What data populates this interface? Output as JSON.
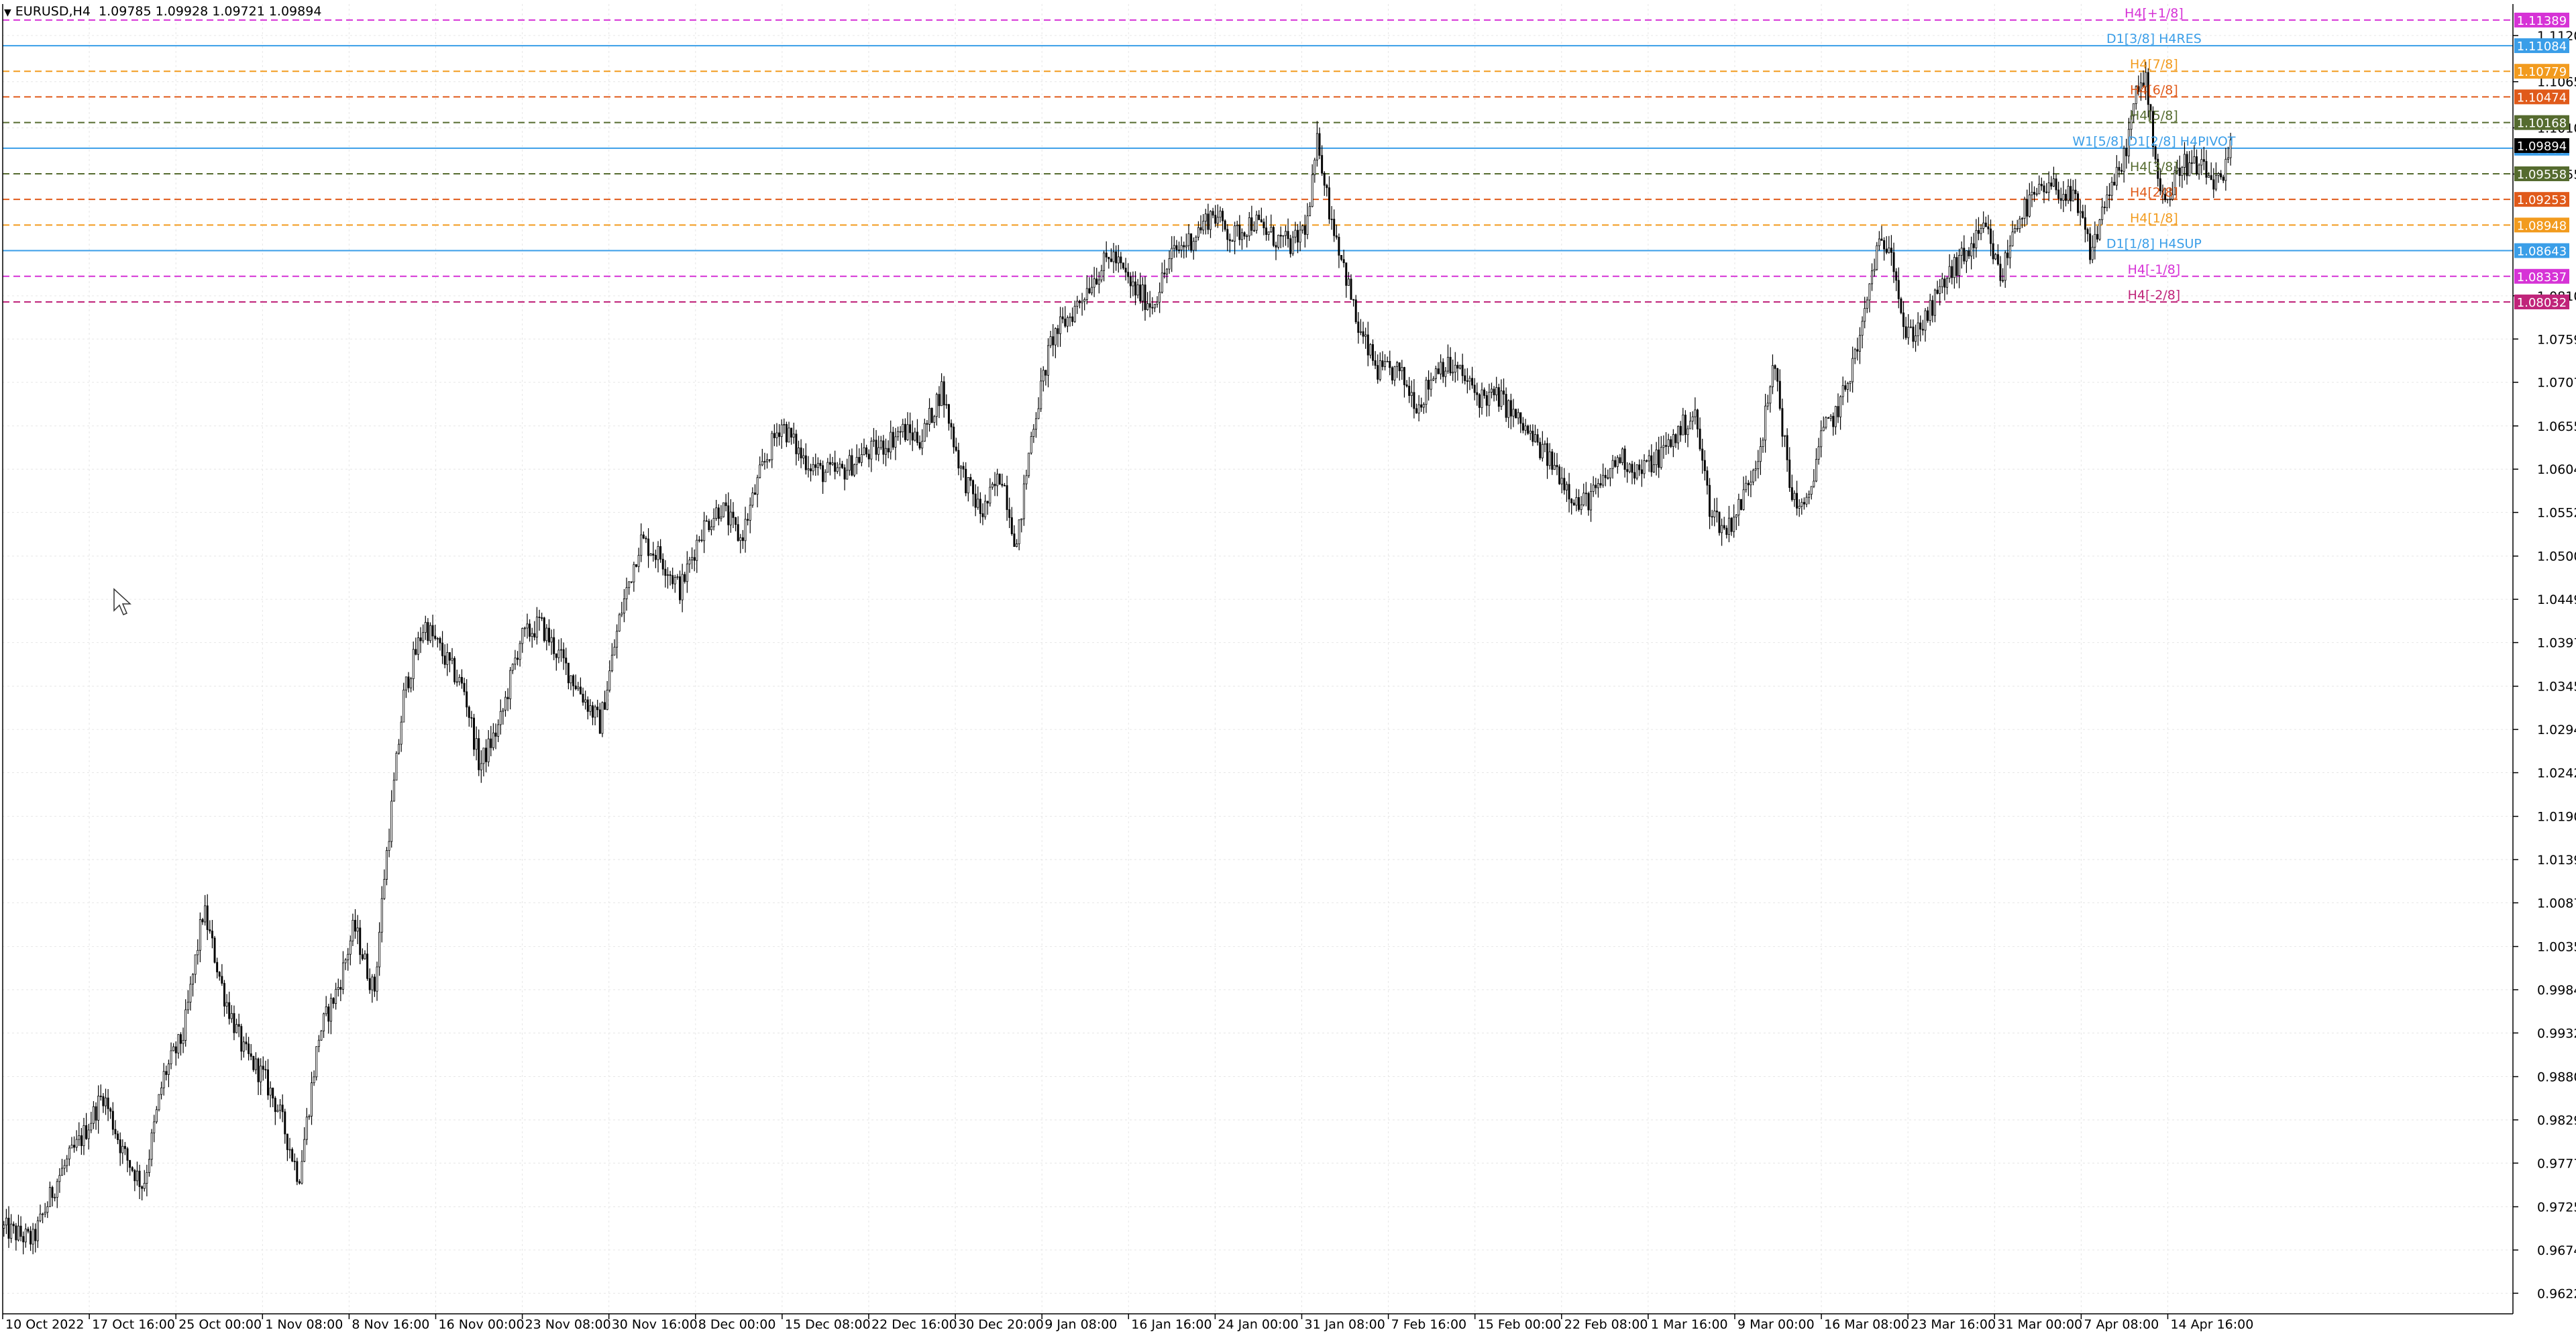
{
  "header": {
    "symbol": "EURUSD,H4",
    "ohlc": "1.09785 1.09928 1.09721 1.09894"
  },
  "chart_data": {
    "type": "candlestick",
    "price_range": [
      0.9598,
      1.1158
    ],
    "y_ticks": [
      "1.11205",
      "1.10655",
      "1.10105",
      "1.09555",
      "1.08105",
      "1.07590",
      "1.07075",
      "1.06555",
      "1.06040",
      "1.05525",
      "1.05005",
      "1.04490",
      "1.03975",
      "1.03455",
      "1.02940",
      "1.02425",
      "1.01905",
      "1.01390",
      "1.00875",
      "1.00355",
      "0.99840",
      "0.99325",
      "0.98805",
      "0.98290",
      "0.97775",
      "0.97255",
      "0.96740",
      "0.96225"
    ],
    "x_ticks": [
      {
        "label": "10 Oct 2022",
        "pos": 0.0
      },
      {
        "label": "17 Oct 16:00",
        "pos": 0.0345
      },
      {
        "label": "25 Oct 00:00",
        "pos": 0.069
      },
      {
        "label": "1 Nov 08:00",
        "pos": 0.1035
      },
      {
        "label": "8 Nov 16:00",
        "pos": 0.138
      },
      {
        "label": "16 Nov 00:00",
        "pos": 0.1725
      },
      {
        "label": "23 Nov 08:00",
        "pos": 0.207
      },
      {
        "label": "30 Nov 16:00",
        "pos": 0.2415
      },
      {
        "label": "8 Dec 00:00",
        "pos": 0.276
      },
      {
        "label": "15 Dec 08:00",
        "pos": 0.3105
      },
      {
        "label": "22 Dec 16:00",
        "pos": 0.345
      },
      {
        "label": "30 Dec 20:00",
        "pos": 0.3795
      },
      {
        "label": "9 Jan 08:00",
        "pos": 0.414
      },
      {
        "label": "16 Jan 16:00",
        "pos": 0.4485
      },
      {
        "label": "24 Jan 00:00",
        "pos": 0.483
      },
      {
        "label": "31 Jan 08:00",
        "pos": 0.5175
      },
      {
        "label": "7 Feb 16:00",
        "pos": 0.552
      },
      {
        "label": "15 Feb 00:00",
        "pos": 0.5865
      },
      {
        "label": "22 Feb 08:00",
        "pos": 0.621
      },
      {
        "label": "1 Mar 16:00",
        "pos": 0.6555
      },
      {
        "label": "9 Mar 00:00",
        "pos": 0.69
      },
      {
        "label": "16 Mar 08:00",
        "pos": 0.7245
      },
      {
        "label": "23 Mar 16:00",
        "pos": 0.759
      },
      {
        "label": "31 Mar 00:00",
        "pos": 0.7935
      },
      {
        "label": "7 Apr 08:00",
        "pos": 0.828
      },
      {
        "label": "14 Apr 16:00",
        "pos": 0.8625
      }
    ],
    "anchors": [
      [
        0.0,
        0.97
      ],
      [
        0.012,
        0.9685
      ],
      [
        0.022,
        0.976
      ],
      [
        0.032,
        0.981
      ],
      [
        0.04,
        0.986
      ],
      [
        0.048,
        0.979
      ],
      [
        0.056,
        0.975
      ],
      [
        0.064,
        0.988
      ],
      [
        0.072,
        0.993
      ],
      [
        0.08,
        1.008
      ],
      [
        0.088,
        0.998
      ],
      [
        0.096,
        0.991
      ],
      [
        0.104,
        0.988
      ],
      [
        0.11,
        0.984
      ],
      [
        0.118,
        0.976
      ],
      [
        0.126,
        0.993
      ],
      [
        0.134,
        0.999
      ],
      [
        0.14,
        1.006
      ],
      [
        0.148,
        0.998
      ],
      [
        0.152,
        1.012
      ],
      [
        0.16,
        1.034
      ],
      [
        0.168,
        1.042
      ],
      [
        0.176,
        1.038
      ],
      [
        0.184,
        1.034
      ],
      [
        0.19,
        1.025
      ],
      [
        0.198,
        1.03
      ],
      [
        0.206,
        1.04
      ],
      [
        0.214,
        1.042
      ],
      [
        0.222,
        1.038
      ],
      [
        0.23,
        1.034
      ],
      [
        0.238,
        1.03
      ],
      [
        0.246,
        1.043
      ],
      [
        0.254,
        1.052
      ],
      [
        0.262,
        1.05
      ],
      [
        0.27,
        1.046
      ],
      [
        0.278,
        1.053
      ],
      [
        0.286,
        1.056
      ],
      [
        0.294,
        1.052
      ],
      [
        0.302,
        1.06
      ],
      [
        0.31,
        1.066
      ],
      [
        0.318,
        1.062
      ],
      [
        0.326,
        1.06
      ],
      [
        0.334,
        1.06
      ],
      [
        0.342,
        1.062
      ],
      [
        0.35,
        1.063
      ],
      [
        0.358,
        1.065
      ],
      [
        0.366,
        1.064
      ],
      [
        0.374,
        1.07
      ],
      [
        0.382,
        1.06
      ],
      [
        0.39,
        1.055
      ],
      [
        0.398,
        1.06
      ],
      [
        0.404,
        1.051
      ],
      [
        0.41,
        1.065
      ],
      [
        0.418,
        1.076
      ],
      [
        0.426,
        1.079
      ],
      [
        0.434,
        1.083
      ],
      [
        0.442,
        1.086
      ],
      [
        0.45,
        1.082
      ],
      [
        0.458,
        1.08
      ],
      [
        0.466,
        1.086
      ],
      [
        0.474,
        1.088
      ],
      [
        0.482,
        1.091
      ],
      [
        0.49,
        1.088
      ],
      [
        0.498,
        1.09
      ],
      [
        0.506,
        1.088
      ],
      [
        0.514,
        1.087
      ],
      [
        0.52,
        1.09
      ],
      [
        0.524,
        1.1
      ],
      [
        0.528,
        1.092
      ],
      [
        0.534,
        1.085
      ],
      [
        0.54,
        1.077
      ],
      [
        0.548,
        1.072
      ],
      [
        0.556,
        1.072
      ],
      [
        0.564,
        1.068
      ],
      [
        0.572,
        1.073
      ],
      [
        0.58,
        1.072
      ],
      [
        0.588,
        1.069
      ],
      [
        0.596,
        1.069
      ],
      [
        0.604,
        1.066
      ],
      [
        0.612,
        1.063
      ],
      [
        0.62,
        1.06
      ],
      [
        0.628,
        1.056
      ],
      [
        0.636,
        1.058
      ],
      [
        0.644,
        1.062
      ],
      [
        0.652,
        1.06
      ],
      [
        0.66,
        1.062
      ],
      [
        0.668,
        1.065
      ],
      [
        0.674,
        1.067
      ],
      [
        0.68,
        1.056
      ],
      [
        0.686,
        1.053
      ],
      [
        0.692,
        1.056
      ],
      [
        0.7,
        1.063
      ],
      [
        0.706,
        1.073
      ],
      [
        0.712,
        1.058
      ],
      [
        0.718,
        1.055
      ],
      [
        0.724,
        1.064
      ],
      [
        0.732,
        1.068
      ],
      [
        0.74,
        1.076
      ],
      [
        0.746,
        1.086
      ],
      [
        0.752,
        1.088
      ],
      [
        0.758,
        1.076
      ],
      [
        0.766,
        1.078
      ],
      [
        0.774,
        1.083
      ],
      [
        0.782,
        1.086
      ],
      [
        0.79,
        1.089
      ],
      [
        0.796,
        1.083
      ],
      [
        0.802,
        1.09
      ],
      [
        0.81,
        1.093
      ],
      [
        0.818,
        1.094
      ],
      [
        0.826,
        1.092
      ],
      [
        0.832,
        1.086
      ],
      [
        0.838,
        1.093
      ],
      [
        0.844,
        1.096
      ],
      [
        0.85,
        1.105
      ],
      [
        0.854,
        1.107
      ],
      [
        0.858,
        1.096
      ],
      [
        0.862,
        1.092
      ],
      [
        0.868,
        1.097
      ],
      [
        0.876,
        1.096
      ],
      [
        0.884,
        1.094
      ],
      [
        0.888,
        1.0989
      ]
    ],
    "murrey_levels": [
      {
        "label": "H4[+1/8]",
        "price": 1.11389,
        "color": "#d633d6",
        "dash": "10,6",
        "tag": "1.11389",
        "tag_color": "#d633d6"
      },
      {
        "label": "D1[3/8] H4RES",
        "price": 1.11084,
        "color": "#3a9ee8",
        "dash": "",
        "tag": "1.11084",
        "tag_color": "#3a9ee8"
      },
      {
        "label": "H4[7/8]",
        "price": 1.10779,
        "color": "#f29b1e",
        "dash": "10,6",
        "tag": "1.10779",
        "tag_color": "#f29b1e"
      },
      {
        "label": "H4[6/8]",
        "price": 1.10474,
        "color": "#e05a1a",
        "dash": "10,6",
        "tag": "1.10474",
        "tag_color": "#e05a1a"
      },
      {
        "label": "H4[5/8]",
        "price": 1.10168,
        "color": "#556b2f",
        "dash": "10,6",
        "tag": "1.10168",
        "tag_color": "#556b2f"
      },
      {
        "label": "W1[5/8] D1[2/8] H4PIVOT",
        "price": 1.09863,
        "color": "#3a9ee8",
        "dash": "",
        "tag": "1.09863",
        "tag_color": "#3a9ee8"
      },
      {
        "label": "H4[3/8]",
        "price": 1.09558,
        "color": "#556b2f",
        "dash": "10,6",
        "tag": "1.09558",
        "tag_color": "#556b2f"
      },
      {
        "label": "H4[2/8]",
        "price": 1.09253,
        "color": "#e05a1a",
        "dash": "10,6",
        "tag": "1.09253",
        "tag_color": "#e05a1a"
      },
      {
        "label": "H4[1/8]",
        "price": 1.08948,
        "color": "#f29b1e",
        "dash": "10,6",
        "tag": "1.08948",
        "tag_color": "#f29b1e"
      },
      {
        "label": "D1[1/8] H4SUP",
        "price": 1.08643,
        "color": "#3a9ee8",
        "dash": "",
        "tag": "1.08643",
        "tag_color": "#3a9ee8"
      },
      {
        "label": "H4[-1/8]",
        "price": 1.08337,
        "color": "#d633d6",
        "dash": "10,6",
        "tag": "1.08337",
        "tag_color": "#d633d6"
      },
      {
        "label": "H4[-2/8]",
        "price": 1.08032,
        "color": "#c0247a",
        "dash": "10,6",
        "tag": "1.08032",
        "tag_color": "#c0247a"
      }
    ],
    "current_price": {
      "price": 1.09894,
      "label": "1.09894"
    },
    "colors": {
      "background": "#ffffff",
      "grid": "#e6e6e6",
      "candle": "#000000",
      "axis": "#000000"
    }
  }
}
